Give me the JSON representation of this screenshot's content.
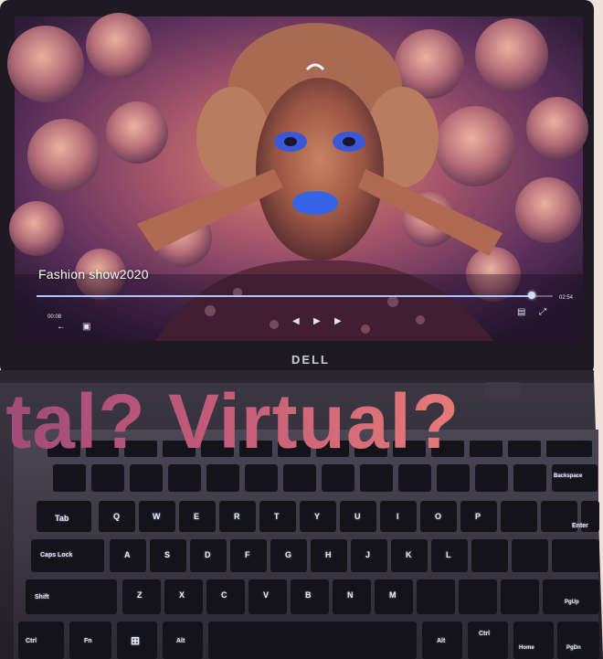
{
  "video": {
    "title": "Fashion show2020",
    "time_current": "00:08",
    "time_total": "02:54",
    "progress": 0.96
  },
  "controls": {
    "back_icon": "back-arrow-icon",
    "cast_icon": "cast-icon",
    "prev_icon": "previous-icon",
    "play_icon": "play-icon",
    "next_icon": "next-icon",
    "caption_icon": "caption-icon",
    "fullscreen_icon": "fullscreen-icon"
  },
  "laptop": {
    "brand": "DELL"
  },
  "headline": {
    "text": "ital? Virtual?"
  },
  "keyboard": {
    "row_qwerty": [
      "Q",
      "W",
      "E",
      "R",
      "T",
      "Y",
      "U",
      "I",
      "O",
      "P"
    ],
    "row_asdf": [
      "A",
      "S",
      "D",
      "F",
      "G",
      "H",
      "J",
      "K",
      "L"
    ],
    "row_zxcv": [
      "Z",
      "X",
      "C",
      "V",
      "B",
      "N",
      "M"
    ],
    "modifiers": {
      "tab": "Tab",
      "caps": "Caps Lock",
      "shift": "Shift",
      "ctrl": "Ctrl",
      "fn": "Fn",
      "alt": "Alt",
      "alt_right": "Alt",
      "ctrl_right": "Ctrl",
      "enter": "Enter",
      "backspace": "Backspace",
      "home": "Home",
      "pgup": "PgUp",
      "pgdn": "PgDn"
    }
  }
}
